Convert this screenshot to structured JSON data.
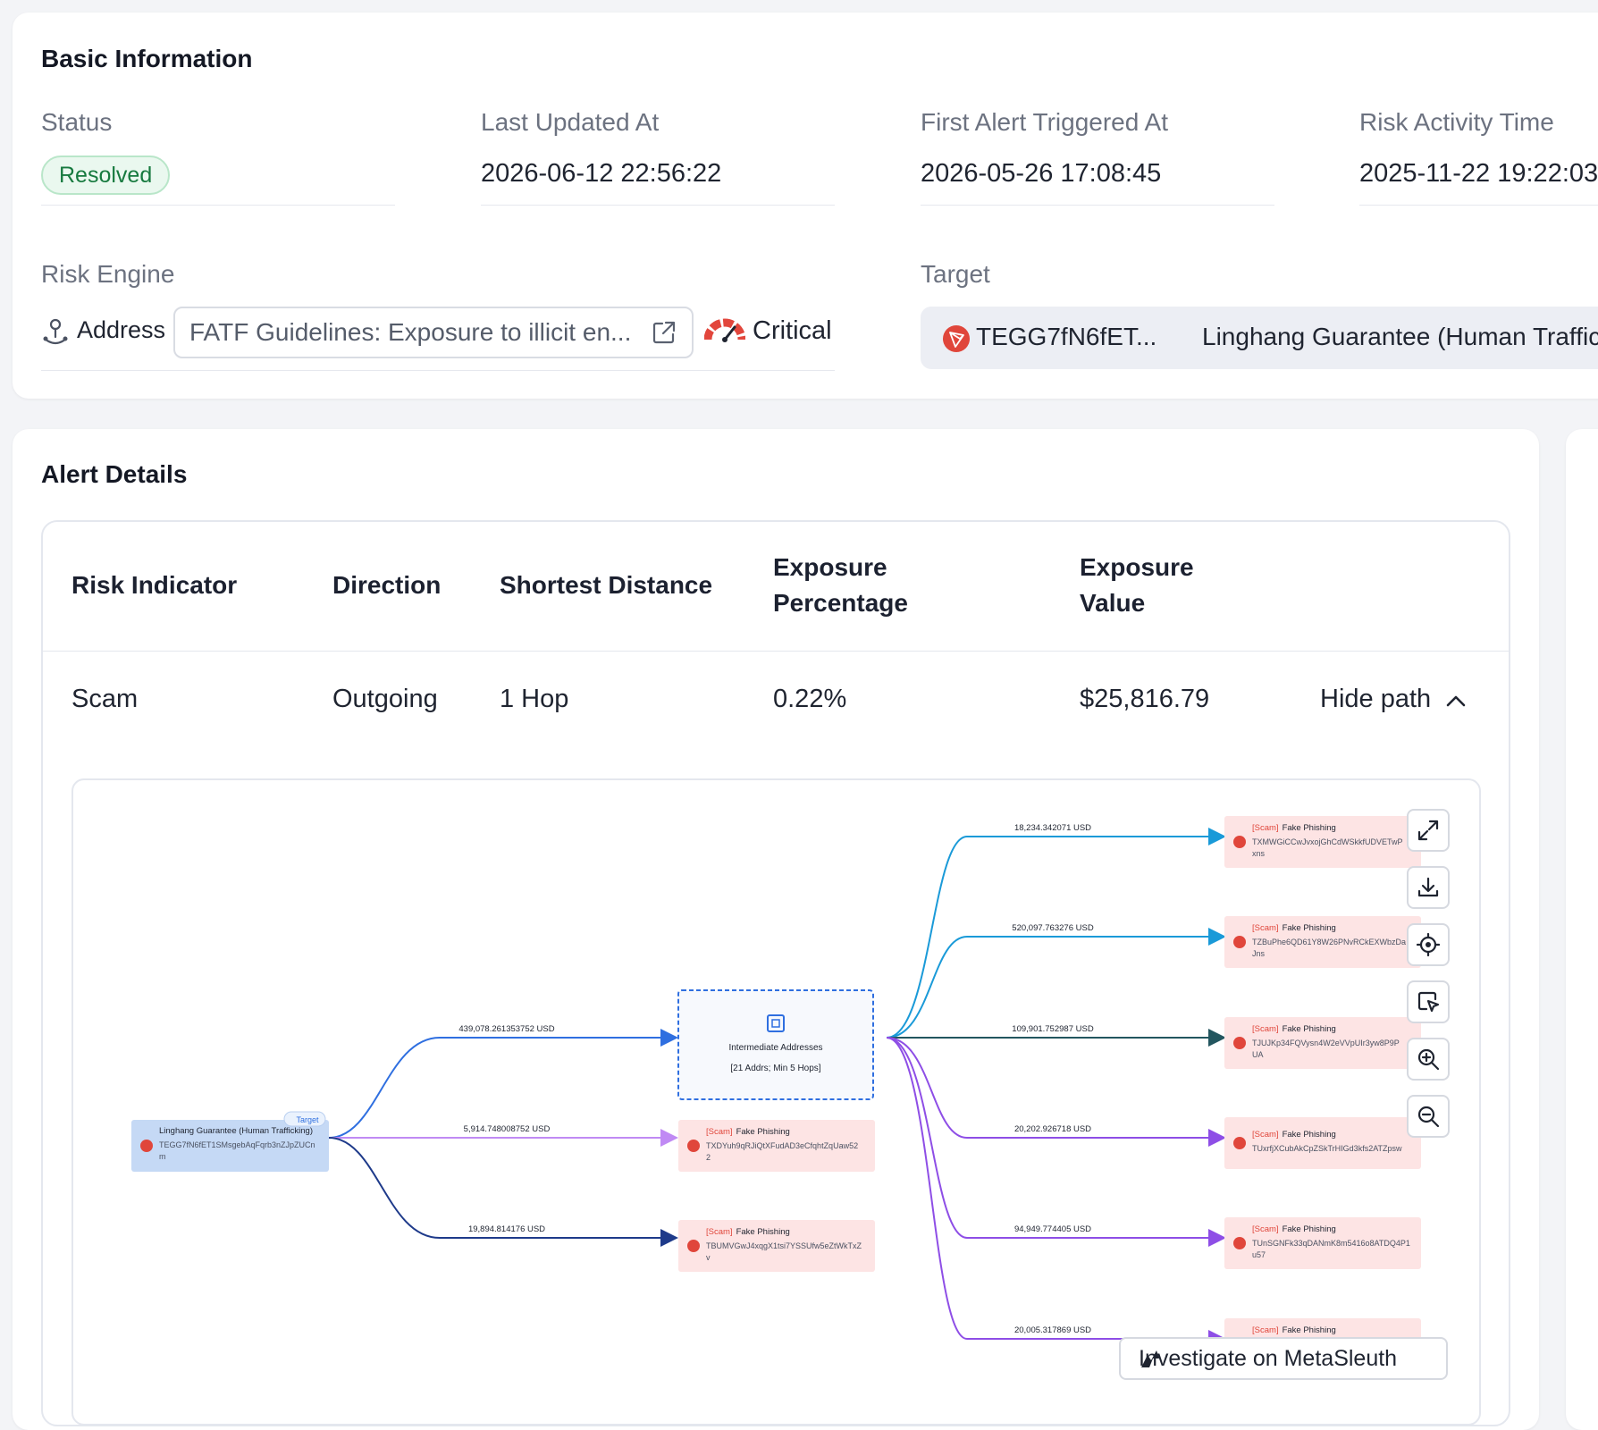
{
  "basic": {
    "title": "Basic Information",
    "status_label": "Status",
    "status_value": "Resolved",
    "last_updated_label": "Last Updated At",
    "last_updated_value": "2026-06-12 22:56:22",
    "first_alert_label": "First Alert Triggered At",
    "first_alert_value": "2026-05-26 17:08:45",
    "risk_activity_label": "Risk Activity Time",
    "risk_activity_value": "2025-11-22 19:22:03",
    "risk_engine_label": "Risk Engine",
    "engine_type": "Address",
    "engine_rule": "FATF Guidelines: Exposure to illicit en...",
    "severity": "Critical",
    "target_label": "Target",
    "target_address": "TEGG7fN6fET...",
    "target_name": "Linghang Guarantee (Human Trafficking)"
  },
  "alert": {
    "title": "Alert Details",
    "headers": {
      "indicator": "Risk Indicator",
      "direction": "Direction",
      "distance": "Shortest Distance",
      "exposure_pct_1": "Exposure",
      "exposure_pct_2": "Percentage",
      "exposure_val_1": "Exposure",
      "exposure_val_2": "Value"
    },
    "row": {
      "indicator": "Scam",
      "direction": "Outgoing",
      "distance": "1 Hop",
      "exposure_pct": "0.22%",
      "exposure_val": "$25,816.79",
      "toggle": "Hide path"
    }
  },
  "graph": {
    "source": {
      "name": "Linghang Guarantee (Human Trafficking)",
      "addr1": "TEGG7fN6fET1SMsgebAqFqrb3nZJpZUCn",
      "addr2": "m",
      "tag": "Target"
    },
    "intermediate": {
      "title": "Intermediate Addresses",
      "sub": "[21 Addrs; Min 5 Hops]"
    },
    "scam_tag": "[Scam]",
    "scam_label": "Fake Phishing",
    "edges": {
      "src_inter": "439,078.261353752 USD",
      "src_mid1": "5,914.748008752 USD",
      "src_mid2": "19,894.814176 USD",
      "r1": "18,234.342071 USD",
      "r2": "520,097.763276 USD",
      "r3": "109,901.752987 USD",
      "r4": "20,202.926718 USD",
      "r5": "94,949.774405 USD",
      "r6": "20,005.317869 USD"
    },
    "mid_nodes": [
      {
        "addr1": "TXDYuh9qRJiQtXFudAD3eCfqhtZqUaw52",
        "addr2": "2"
      },
      {
        "addr1": "TBUMVGwJ4xqgX1tsi7YSSUfw5eZtWkTxZ",
        "addr2": "v"
      }
    ],
    "right_nodes": [
      {
        "addr1": "TXMWGiCCwJvxojGhCdWSkkfUDVETwP",
        "addr2": "xns"
      },
      {
        "addr1": "TZBuPhe6QD61Y8W26PNvRCkEXWbzDa",
        "addr2": "Jns"
      },
      {
        "addr1": "TJUJKp34FQVysn4W2eVVpUIr3yw8P9P",
        "addr2": "UA"
      },
      {
        "addr1": "TUxrfjXCubAkCpZSkTrHIGd3kfs2ATZpsw",
        "addr2": ""
      },
      {
        "addr1": "TUnSGNFk33qDANmK8m5416o8ATDQ4P1",
        "addr2": "u57"
      },
      {
        "addr1": "",
        "addr2": ""
      }
    ],
    "investigate": "Investigate on MetaSleuth",
    "colors": {
      "blue": "#2f6fe0",
      "cyan": "#1a9ad8",
      "teal": "#23565f",
      "purple": "#8e4ee6",
      "light_purple": "#c08af4",
      "navy": "#1e3a8a",
      "scam_bg": "#fde4e4",
      "source_bg": "#c5d9f5"
    }
  }
}
